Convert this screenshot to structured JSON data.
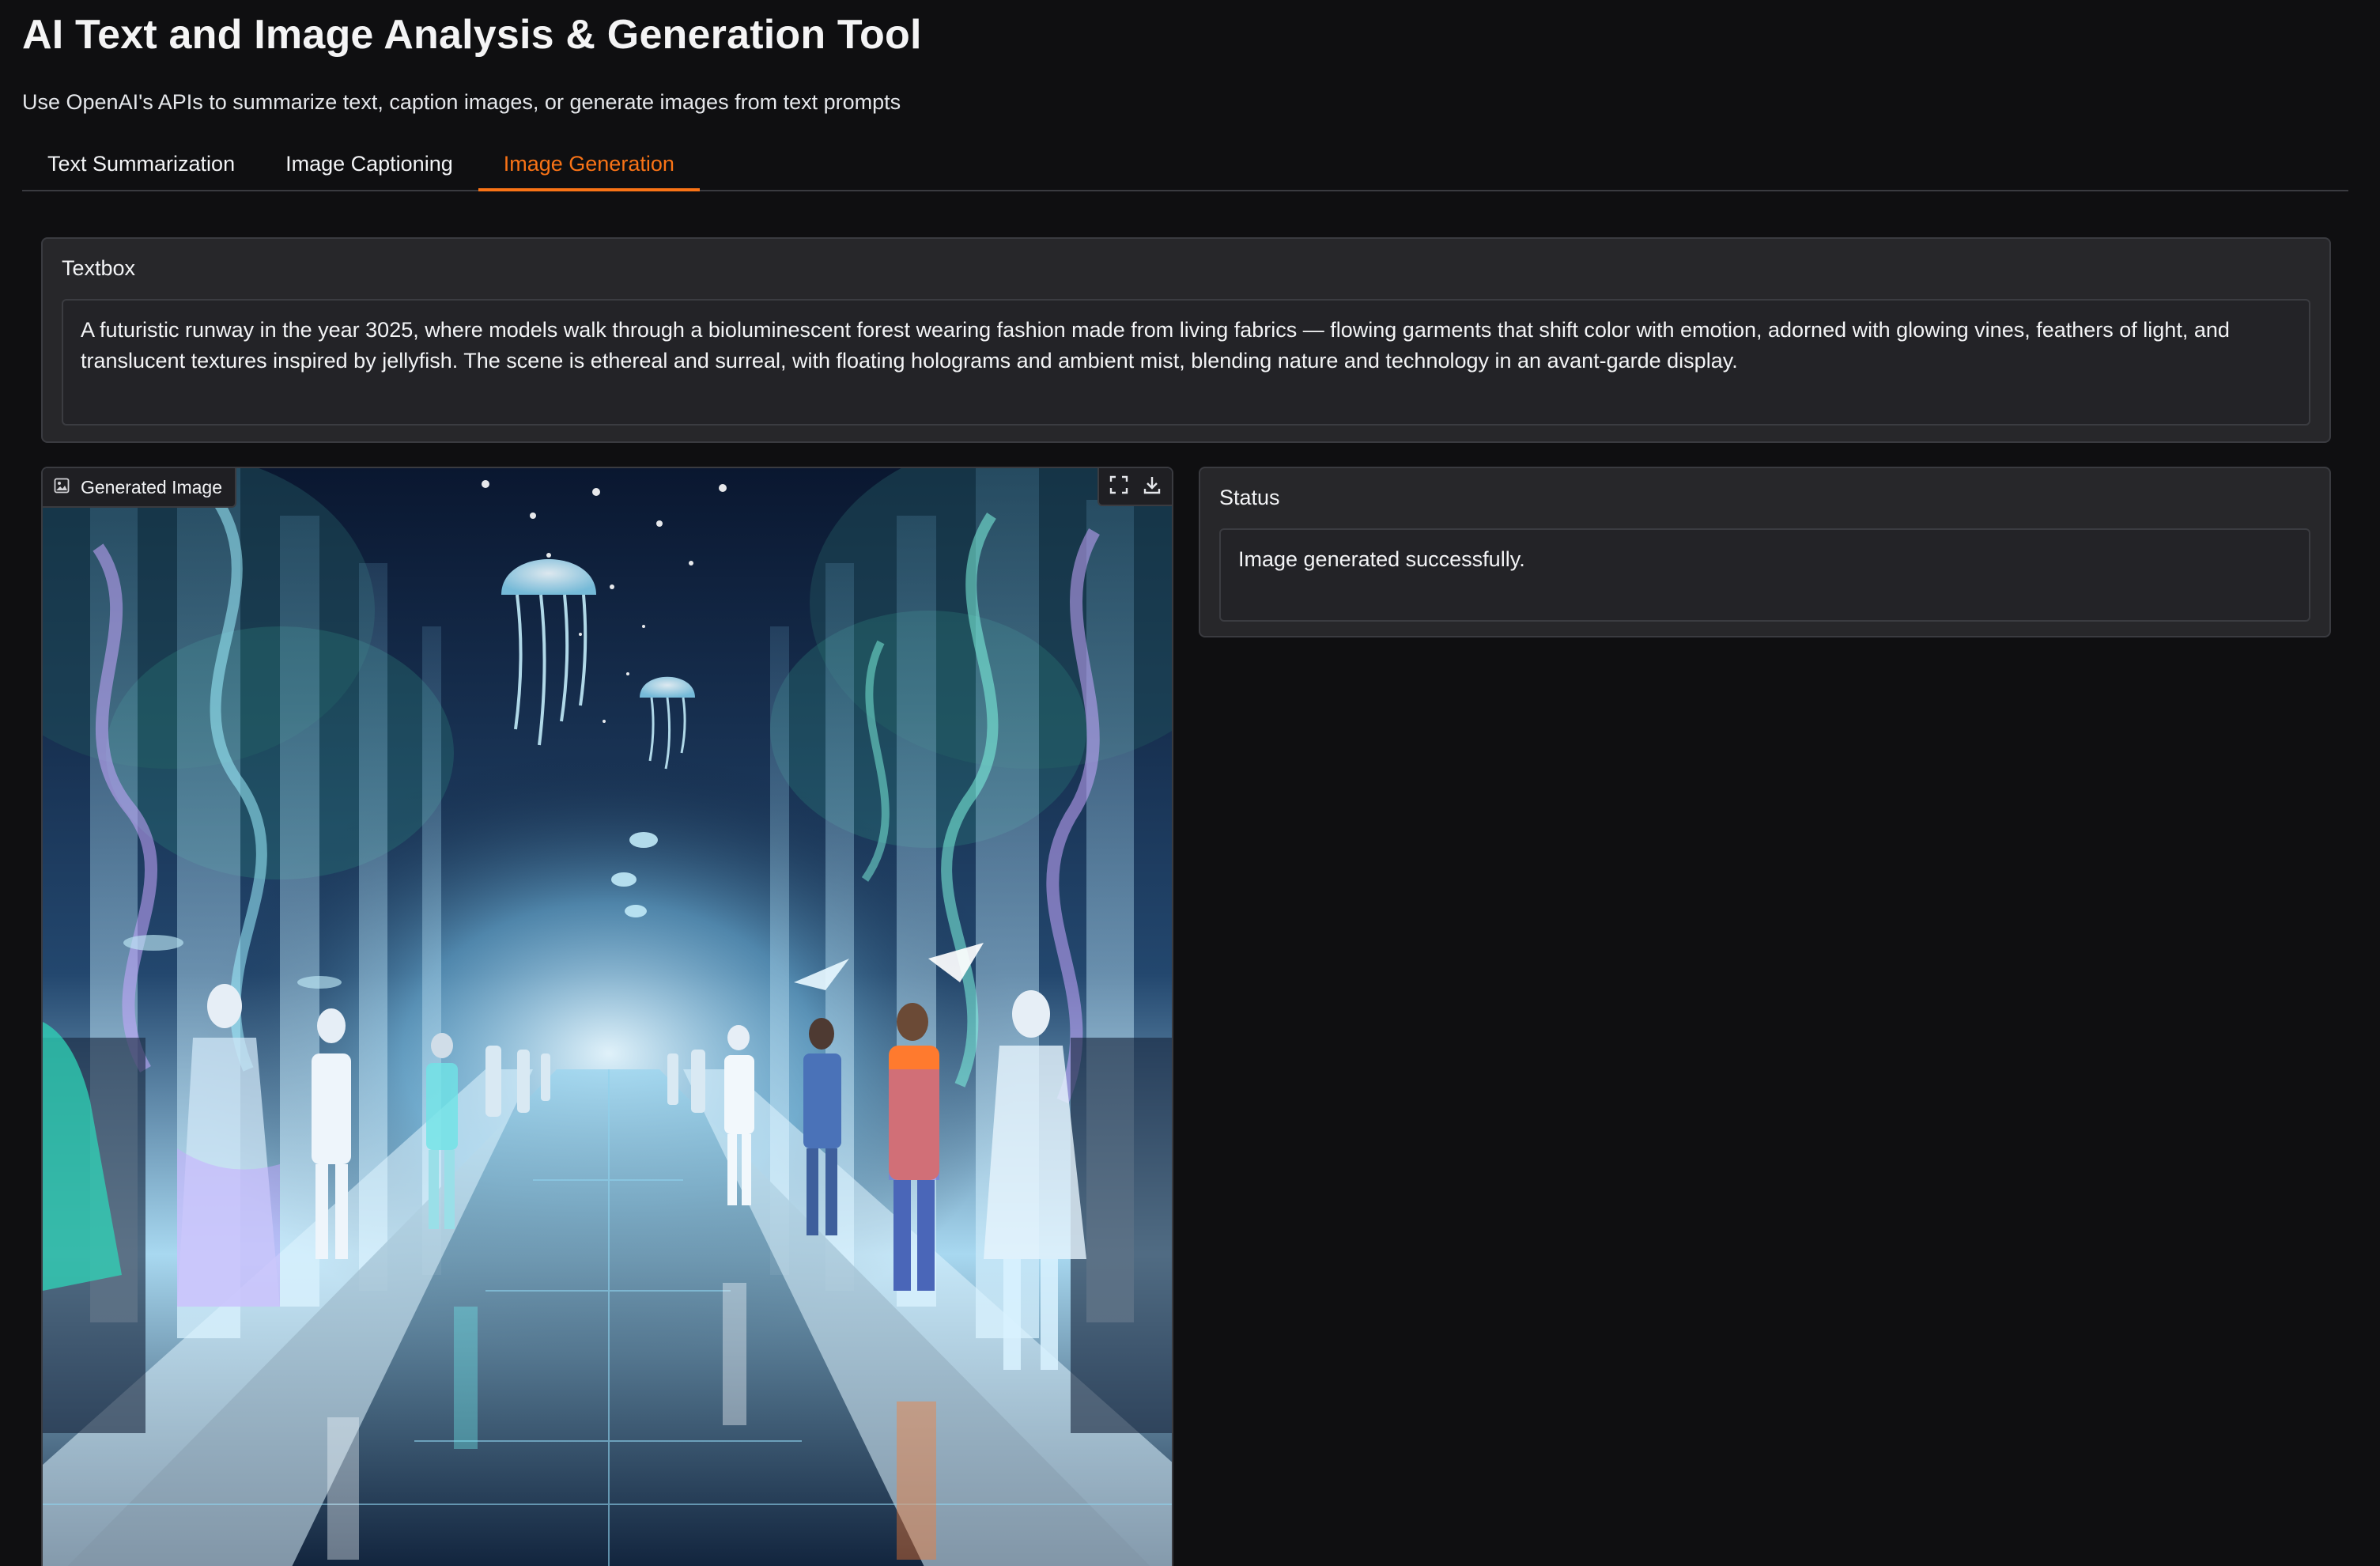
{
  "app": {
    "title": "AI Text and Image Analysis & Generation Tool",
    "subtitle": "Use OpenAI's APIs to summarize text, caption images, or generate images from text prompts"
  },
  "tabs": [
    {
      "label": "Text Summarization",
      "active": false
    },
    {
      "label": "Image Captioning",
      "active": false
    },
    {
      "label": "Image Generation",
      "active": true
    }
  ],
  "textbox": {
    "label": "Textbox",
    "value": "A futuristic runway in the year 3025, where models walk through a bioluminescent forest wearing fashion made from living fabrics — flowing garments that shift color with emotion, adorned with glowing vines, feathers of light, and translucent textures inspired by jellyfish. The scene is ethereal and surreal, with floating holograms and ambient mist, blending nature and technology in an avant-garde display."
  },
  "generated_image": {
    "label": "Generated Image",
    "label_icon": "image-icon",
    "tools": [
      "fullscreen-icon",
      "download-icon"
    ]
  },
  "status": {
    "label": "Status",
    "value": "Image generated successfully."
  },
  "colors": {
    "background": "#0f0f11",
    "panel": "#27272a",
    "field": "#232327",
    "border": "#3a3b40",
    "accent": "#f97316",
    "text": "#f3f4f6"
  }
}
